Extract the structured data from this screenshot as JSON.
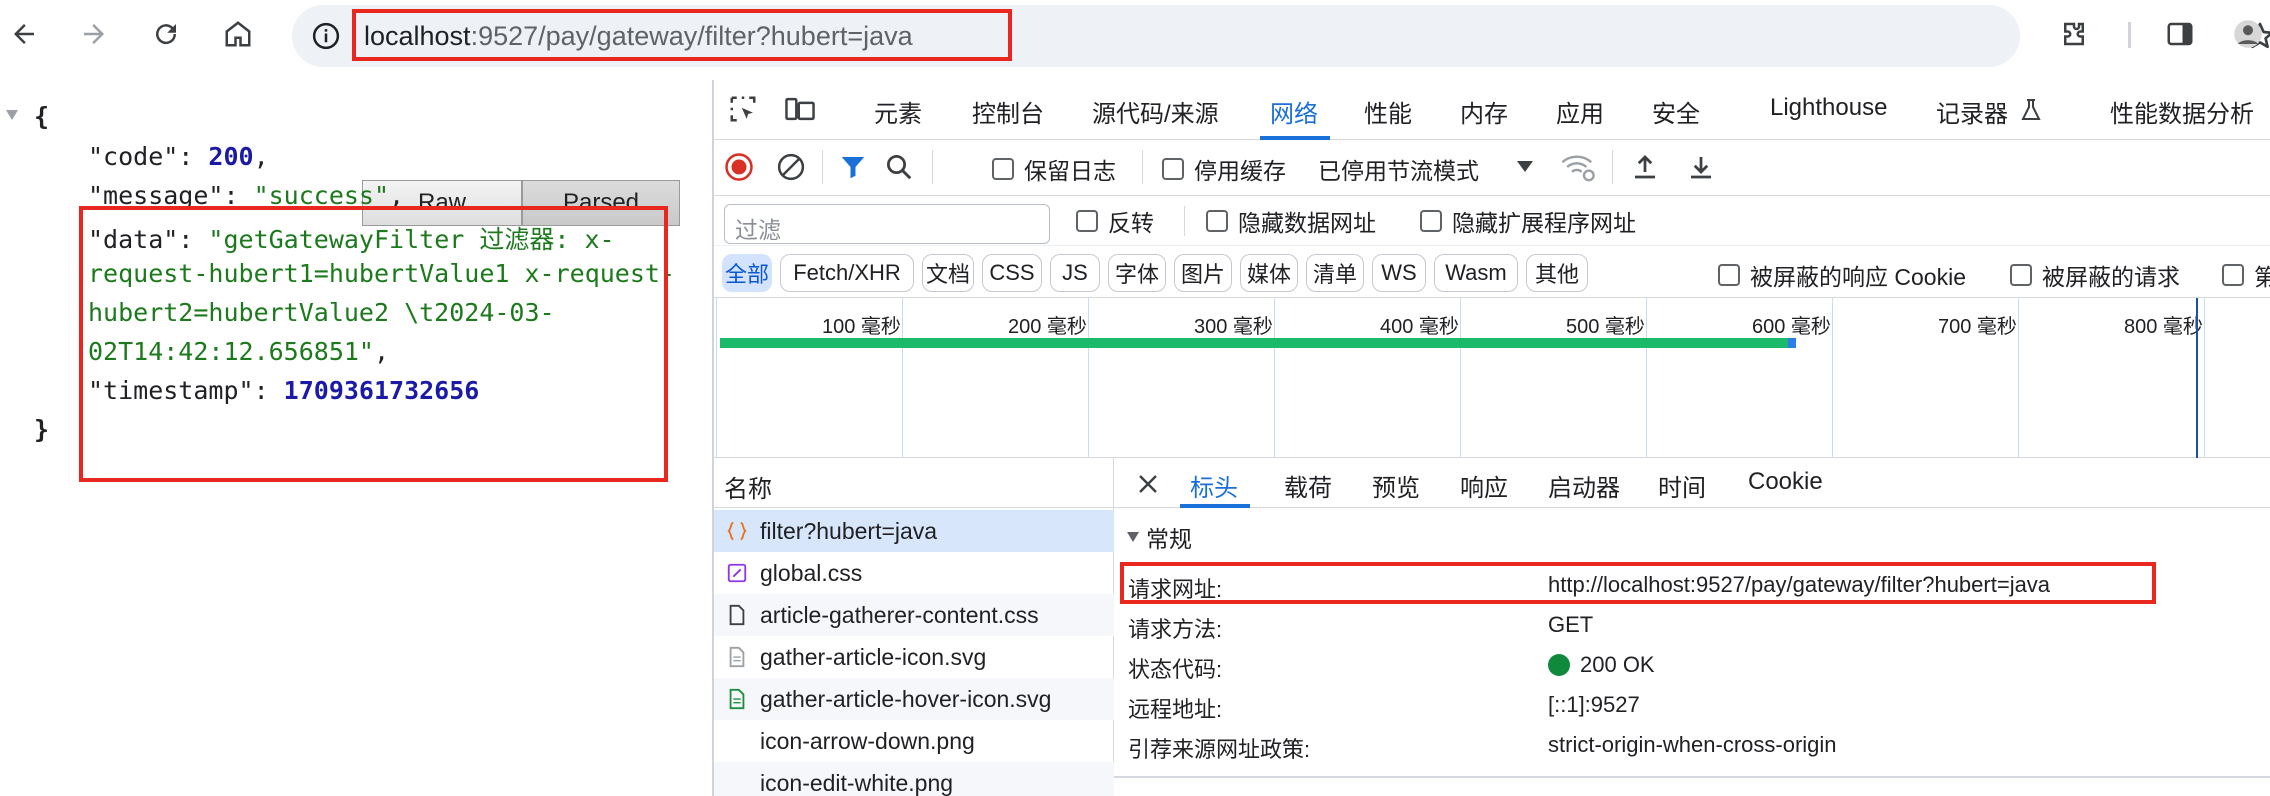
{
  "browser": {
    "url_host": "localhost",
    "url_rest": ":9527/pay/gateway/filter?hubert=java"
  },
  "json_view": {
    "open_brace": "{",
    "close_brace": "}",
    "raw_label": "Raw",
    "parsed_label": "Parsed",
    "code_key": "\"code\": ",
    "code_value": "200",
    "message_key": "\"message\": ",
    "message_value": "\"success\"",
    "data_key": "\"data\": ",
    "data_value_line1": "\"getGatewayFilter 过滤器: x-",
    "data_value_line2": "request-hubert1=hubertValue1 x-request-",
    "data_value_line3": "hubert2=hubertValue2 \\t2024-03-",
    "data_value_line4": "02T14:42:12.656851\"",
    "timestamp_key": "\"timestamp\": ",
    "timestamp_value": "1709361732656",
    "comma": ","
  },
  "devtools": {
    "tabs": [
      "元素",
      "控制台",
      "源代码/来源",
      "网络",
      "性能",
      "内存",
      "应用",
      "安全",
      "Lighthouse",
      "记录器",
      "性能数据分析"
    ],
    "active_tab": "网络",
    "toolbar": {
      "preserve_log": "保留日志",
      "disable_cache": "停用缓存",
      "throttle": "已停用节流模式"
    },
    "filter": {
      "placeholder": "过滤",
      "invert": "反转",
      "hide_data_urls": "隐藏数据网址",
      "hide_ext_urls": "隐藏扩展程序网址"
    },
    "types": [
      "全部",
      "Fetch/XHR",
      "文档",
      "CSS",
      "JS",
      "字体",
      "图片",
      "媒体",
      "清单",
      "WS",
      "Wasm",
      "其他"
    ],
    "blocked_cookies": "被屏蔽的响应 Cookie",
    "blocked_requests": "被屏蔽的请求",
    "third_party_cut": "第",
    "timeline_ticks": [
      "100 毫秒",
      "200 毫秒",
      "300 毫秒",
      "400 毫秒",
      "500 毫秒",
      "600 毫秒",
      "700 毫秒",
      "800 毫秒"
    ],
    "names_header": "名称",
    "requests": [
      "filter?hubert=java",
      "global.css",
      "article-gatherer-content.css",
      "gather-article-icon.svg",
      "gather-article-hover-icon.svg",
      "icon-arrow-down.png",
      "icon-edit-white.png"
    ],
    "detail_tabs": [
      "标头",
      "载荷",
      "预览",
      "响应",
      "启动器",
      "时间",
      "Cookie"
    ],
    "general_section": "常规",
    "general": {
      "request_url_key": "请求网址:",
      "request_url_value": "http://localhost:9527/pay/gateway/filter?hubert=java",
      "method_key": "请求方法:",
      "method_value": "GET",
      "status_key": "状态代码:",
      "status_value": "200 OK",
      "remote_key": "远程地址:",
      "remote_value": "[::1]:9527",
      "referrer_key": "引荐来源网址政策:",
      "referrer_value": "strict-origin-when-cross-origin"
    }
  },
  "colors": {
    "accent": "#1a6fd8",
    "highlight_red": "#e8281f",
    "status_green": "#0f8a3c",
    "json_number": "#1a1aa6",
    "json_string": "#1c7a1c"
  }
}
